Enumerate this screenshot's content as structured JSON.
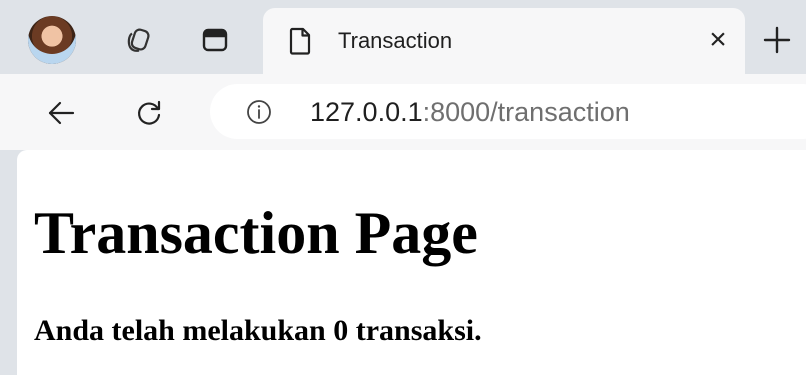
{
  "browser": {
    "tab": {
      "title": "Transaction",
      "close_label": "×"
    },
    "icons": {
      "avatar": "profile-avatar",
      "workspaces": "workspaces-icon",
      "tab_actions": "tab-actions-icon",
      "page": "page-icon",
      "new_tab": "plus-icon",
      "back": "back-arrow-icon",
      "refresh": "refresh-icon",
      "site_info": "info-icon"
    },
    "address_bar": {
      "host": "127.0.0.1",
      "rest": ":8000/transaction"
    }
  },
  "page": {
    "title": "Transaction Page",
    "message": "Anda telah melakukan 0 transaksi."
  },
  "colors": {
    "frame": "#dfe3e8",
    "toolbar": "#f7f7f8",
    "page_bg": "#ffffff",
    "text": "#000000",
    "url_muted": "#6f6f6f"
  }
}
